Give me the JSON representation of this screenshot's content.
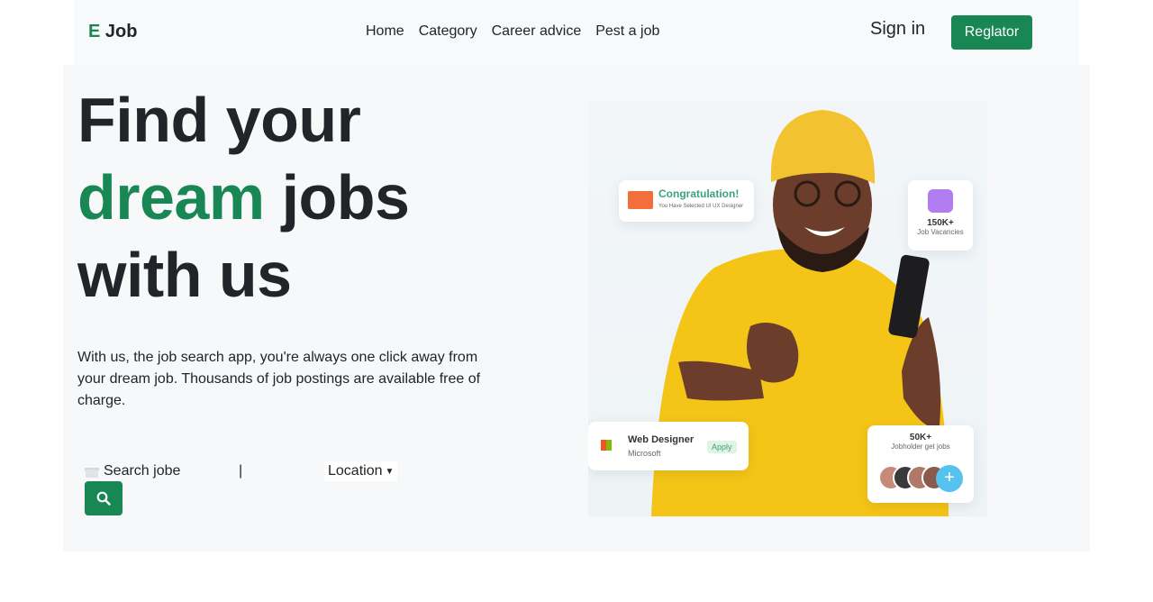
{
  "nav": {
    "brand_prefix": "E",
    "brand_name": "Job",
    "links": [
      "Home",
      "Category",
      "Career advice",
      "Pest a job"
    ],
    "signin": "Sign in",
    "register": "Reglator"
  },
  "hero": {
    "line1": "Find your",
    "line2_green": "dream",
    "line2_rest": "jobs",
    "line3": "with us",
    "description": "With us, the job search app, you're always one click away from your dream job. Thousands of job postings are available free of charge."
  },
  "search": {
    "label": "Search jobe",
    "divider": "|",
    "location": "Location"
  },
  "image_cards": {
    "congrats_title": "Congratulation!",
    "congrats_sub": "You Have Selected UI UX Designer",
    "vacancies_count": "150K+",
    "vacancies_label": "Job Vacancies",
    "job_title": "Web Designer",
    "job_company": "Microsoft",
    "apply": "Apply",
    "holders_count": "50K+",
    "holders_label": "Jobholder get jobs"
  },
  "colors": {
    "accent": "#198754",
    "navbar_bg": "#f8f9fa",
    "hero_bg": "#f7f8fa"
  }
}
